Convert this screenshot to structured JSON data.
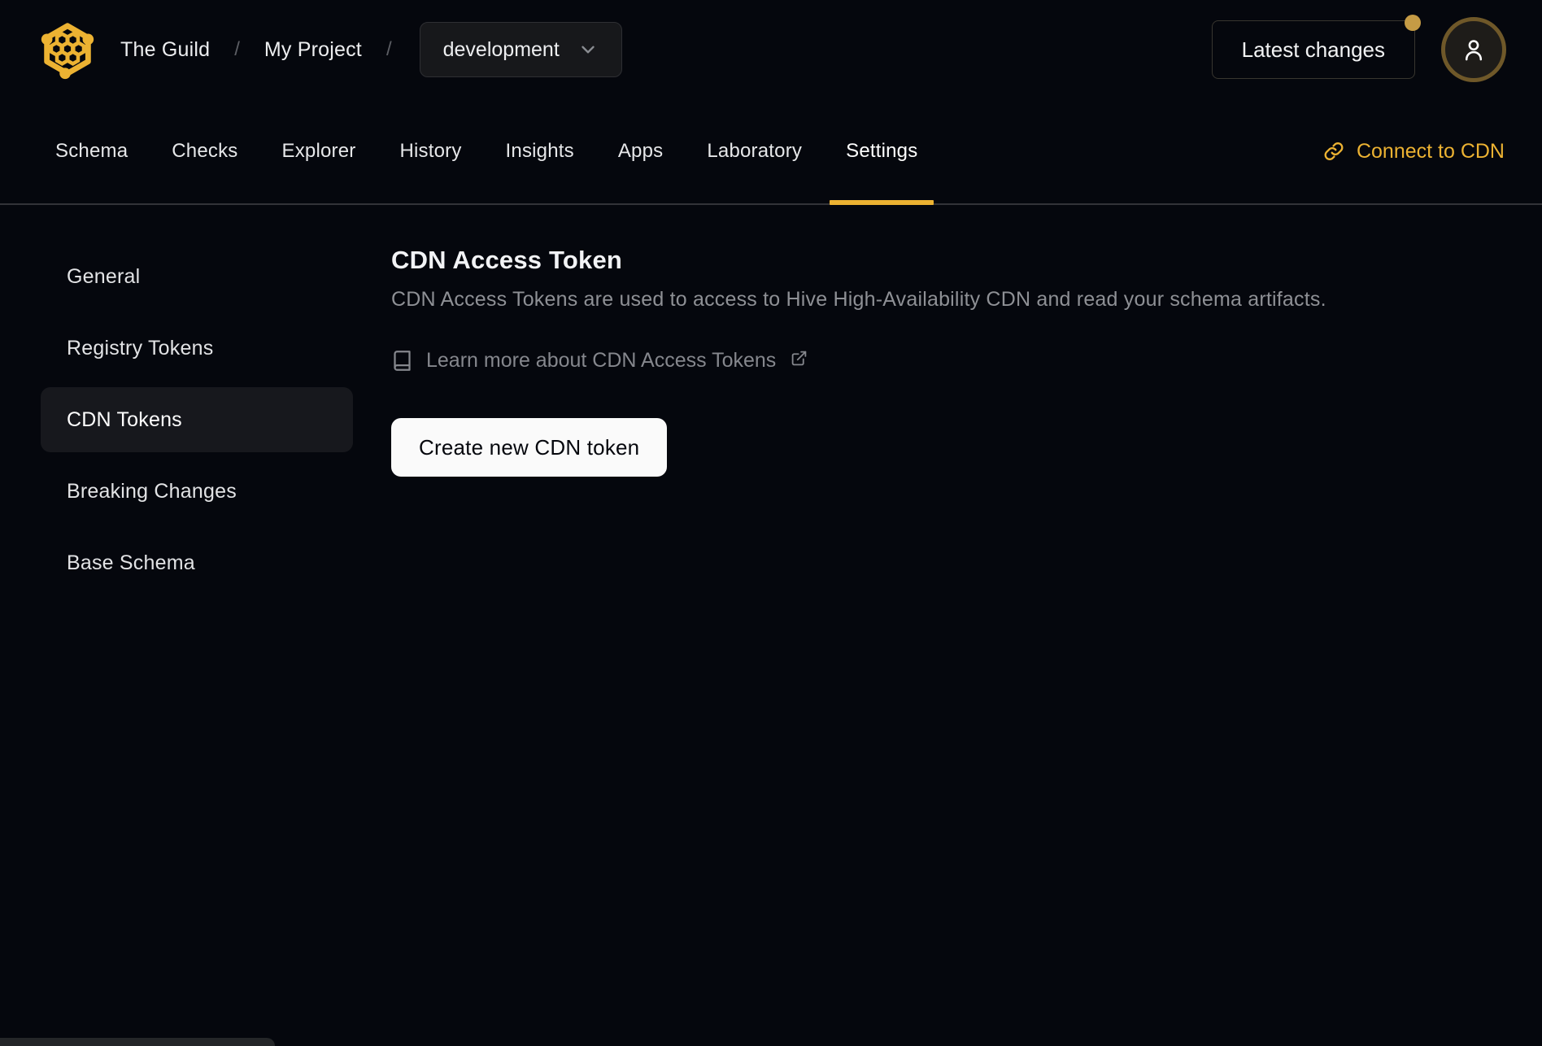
{
  "colors": {
    "accent": "#ECB232",
    "page_background": "#05070D",
    "button_background": "#FAFAFA",
    "notification_dot": "#C59B45"
  },
  "header": {
    "logo_icon": "hive-honeycomb-logo",
    "org": "The Guild",
    "separator": "/",
    "project": "My Project",
    "target_selector": {
      "value": "development",
      "icon": "chevron-down-icon"
    },
    "latest_changes": {
      "label": "Latest changes",
      "has_notification": true
    },
    "avatar_icon": "user-icon"
  },
  "tabs": {
    "items": [
      {
        "label": "Schema",
        "active": false
      },
      {
        "label": "Checks",
        "active": false
      },
      {
        "label": "Explorer",
        "active": false
      },
      {
        "label": "History",
        "active": false
      },
      {
        "label": "Insights",
        "active": false
      },
      {
        "label": "Apps",
        "active": false
      },
      {
        "label": "Laboratory",
        "active": false
      },
      {
        "label": "Settings",
        "active": true
      }
    ],
    "connect_cdn": {
      "label": "Connect to CDN",
      "icon": "link-icon"
    }
  },
  "sidebar": {
    "items": [
      {
        "label": "General",
        "active": false
      },
      {
        "label": "Registry Tokens",
        "active": false
      },
      {
        "label": "CDN Tokens",
        "active": true
      },
      {
        "label": "Breaking Changes",
        "active": false
      },
      {
        "label": "Base Schema",
        "active": false
      }
    ]
  },
  "main": {
    "title": "CDN Access Token",
    "description": "CDN Access Tokens are used to access to Hive High-Availability CDN and read your schema artifacts.",
    "learn_more": {
      "label": "Learn more about CDN Access Tokens",
      "left_icon": "book-icon",
      "right_icon": "external-link-icon"
    },
    "create_button_label": "Create new CDN token"
  }
}
